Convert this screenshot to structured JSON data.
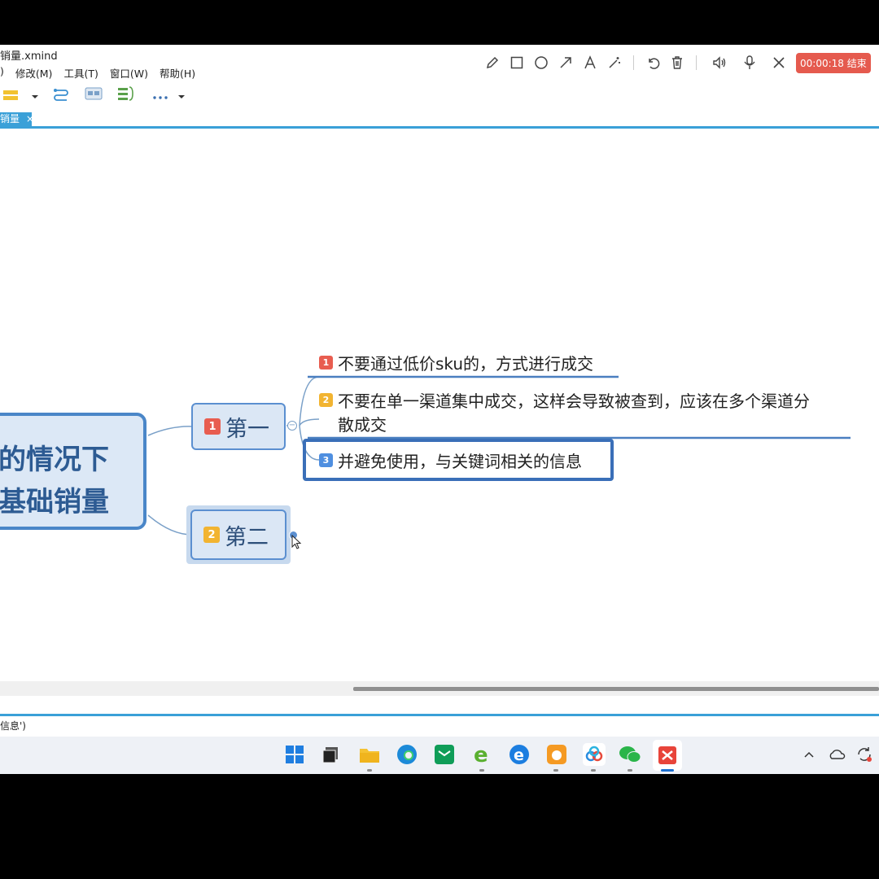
{
  "window": {
    "title": "销量.xmind"
  },
  "menu": [
    ")",
    "修改(M)",
    "工具(T)",
    "窗口(W)",
    "帮助(H)"
  ],
  "recorder": {
    "timer": "00:00:18 结束"
  },
  "tab": {
    "label": "销量"
  },
  "mindmap": {
    "central": {
      "line1": "的情况下",
      "line2": "基础销量"
    },
    "branches": [
      {
        "badge": "1",
        "label": "第一"
      },
      {
        "badge": "2",
        "label": "第二"
      }
    ],
    "subtopics": [
      {
        "badge": "1",
        "text": "不要通过低价sku的，方式进行成交"
      },
      {
        "badge": "2",
        "line1": "不要在单一渠道集中成交，这样会导致被查到，应该在多个渠道分",
        "line2": "散成交"
      },
      {
        "badge": "3",
        "text": "并避免使用，与关键词相关的信息"
      }
    ]
  },
  "statusbar": {
    "text": "信息')"
  }
}
